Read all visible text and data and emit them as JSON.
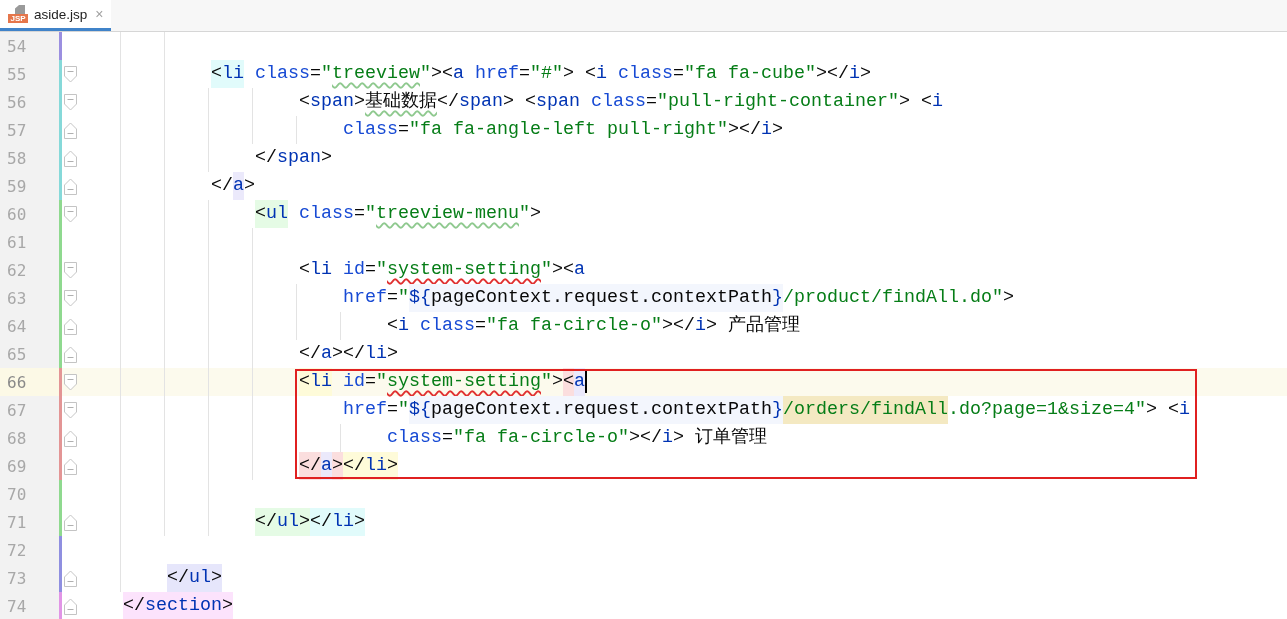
{
  "tab": {
    "title": "aside.jsp",
    "icon_text": "JSP",
    "close": "×",
    "selected": true
  },
  "lines": [
    {
      "number": "54",
      "color": "#9b8fe0",
      "fold_start": false,
      "fold_end": false
    },
    {
      "number": "55",
      "color": "#86d9d9",
      "fold_start": true,
      "fold_end": false,
      "tokens": [
        {
          "text": "            <",
          "kind": "punct",
          "color": "#e1fbfb"
        },
        {
          "text": "li",
          "kind": "tag",
          "color": "#e1fbfb"
        },
        {
          "text": " class",
          "kind": "attr"
        },
        {
          "text": "=",
          "kind": "punct"
        },
        {
          "text": "\"",
          "kind": "str"
        },
        {
          "text": "treeview",
          "kind": "str",
          "misspelled": true
        },
        {
          "text": "\"",
          "kind": "str"
        },
        {
          "text": "><",
          "kind": "punct"
        },
        {
          "text": "a",
          "kind": "tag"
        },
        {
          "text": " href",
          "kind": "attr"
        },
        {
          "text": "=",
          "kind": "punct"
        },
        {
          "text": "\"#\"",
          "kind": "str"
        },
        {
          "text": "> <",
          "kind": "punct"
        },
        {
          "text": "i",
          "kind": "tag"
        },
        {
          "text": " class",
          "kind": "attr"
        },
        {
          "text": "=",
          "kind": "punct"
        },
        {
          "text": "\"fa fa-cube\"",
          "kind": "str"
        },
        {
          "text": "></",
          "kind": "punct"
        },
        {
          "text": "i",
          "kind": "tag"
        },
        {
          "text": ">",
          "kind": "punct"
        }
      ]
    },
    {
      "number": "56",
      "color": "#86d9d9",
      "fold_start": true,
      "fold_end": false,
      "tokens": [
        {
          "text": "                    <",
          "kind": "punct"
        },
        {
          "text": "span",
          "kind": "tag"
        },
        {
          "text": ">",
          "kind": "punct"
        },
        {
          "text": "基础数据",
          "kind": "text",
          "misspelled": true
        },
        {
          "text": "</",
          "kind": "punct"
        },
        {
          "text": "span",
          "kind": "tag"
        },
        {
          "text": "> <",
          "kind": "punct"
        },
        {
          "text": "span",
          "kind": "tag"
        },
        {
          "text": " class",
          "kind": "attr"
        },
        {
          "text": "=",
          "kind": "punct"
        },
        {
          "text": "\"pull-right-container\"",
          "kind": "str"
        },
        {
          "text": "> <",
          "kind": "punct"
        },
        {
          "text": "i",
          "kind": "tag"
        }
      ]
    },
    {
      "number": "57",
      "color": "#86d9d9",
      "fold_start": false,
      "fold_end": true,
      "tokens": [
        {
          "text": "                        class",
          "kind": "attr"
        },
        {
          "text": "=",
          "kind": "punct"
        },
        {
          "text": "\"fa fa-angle-left pull-right\"",
          "kind": "str"
        },
        {
          "text": "></",
          "kind": "punct"
        },
        {
          "text": "i",
          "kind": "tag"
        },
        {
          "text": ">",
          "kind": "punct"
        }
      ]
    },
    {
      "number": "58",
      "color": "#86d9d9",
      "fold_start": false,
      "fold_end": true,
      "tokens": [
        {
          "text": "                </",
          "kind": "punct"
        },
        {
          "text": "span",
          "kind": "tag"
        },
        {
          "text": ">",
          "kind": "punct"
        }
      ]
    },
    {
      "number": "59",
      "color": "#86d9d9",
      "fold_start": false,
      "fold_end": true,
      "tokens": [
        {
          "text": "            </",
          "kind": "punct"
        },
        {
          "text": "a",
          "kind": "tag",
          "color": "#ebe9fb"
        },
        {
          "text": ">",
          "kind": "punct"
        }
      ]
    },
    {
      "number": "60",
      "color": "#8fd98f",
      "fold_start": true,
      "fold_end": false,
      "tokens": [
        {
          "text": "                <",
          "kind": "punct",
          "color": "#e5fbe5"
        },
        {
          "text": "ul",
          "kind": "tag",
          "color": "#e5fbe5"
        },
        {
          "text": " class",
          "kind": "attr"
        },
        {
          "text": "=",
          "kind": "punct"
        },
        {
          "text": "\"",
          "kind": "str"
        },
        {
          "text": "treeview-menu",
          "kind": "str",
          "misspelled": true
        },
        {
          "text": "\"",
          "kind": "str"
        },
        {
          "text": ">",
          "kind": "punct"
        }
      ]
    },
    {
      "number": "61",
      "color": "#8fd98f",
      "fold_start": false,
      "fold_end": false
    },
    {
      "number": "62",
      "color": "#8fd98f",
      "fold_start": true,
      "fold_end": false,
      "tokens": [
        {
          "text": "                    <",
          "kind": "punct"
        },
        {
          "text": "li",
          "kind": "tag"
        },
        {
          "text": " id",
          "kind": "attr"
        },
        {
          "text": "=",
          "kind": "punct"
        },
        {
          "text": "\"",
          "kind": "str"
        },
        {
          "text": "system-setting",
          "kind": "str",
          "error": true
        },
        {
          "text": "\"",
          "kind": "str"
        },
        {
          "text": "><",
          "kind": "punct"
        },
        {
          "text": "a",
          "kind": "tag"
        }
      ]
    },
    {
      "number": "63",
      "color": "#8fd98f",
      "fold_start": true,
      "fold_end": false,
      "tokens": [
        {
          "text": "                        href",
          "kind": "attr"
        },
        {
          "text": "=",
          "kind": "punct"
        },
        {
          "text": "\"",
          "kind": "str"
        },
        {
          "text": "${",
          "kind": "el",
          "color": "#f3f6fd"
        },
        {
          "text": "pageContext.request.contextPath",
          "kind": "text",
          "color": "#f3f6fd"
        },
        {
          "text": "}",
          "kind": "el",
          "color": "#f3f6fd"
        },
        {
          "text": "/product/findAll.do\"",
          "kind": "str"
        },
        {
          "text": ">",
          "kind": "punct"
        }
      ]
    },
    {
      "number": "64",
      "color": "#8fd98f",
      "fold_start": false,
      "fold_end": true,
      "tokens": [
        {
          "text": "                            <",
          "kind": "punct"
        },
        {
          "text": "i",
          "kind": "tag"
        },
        {
          "text": " class",
          "kind": "attr"
        },
        {
          "text": "=",
          "kind": "punct"
        },
        {
          "text": "\"fa fa-circle-o\"",
          "kind": "str"
        },
        {
          "text": "></",
          "kind": "punct"
        },
        {
          "text": "i",
          "kind": "tag"
        },
        {
          "text": ">",
          "kind": "punct"
        },
        {
          "text": " 产品管理",
          "kind": "text"
        }
      ]
    },
    {
      "number": "65",
      "color": "#8fd98f",
      "fold_start": false,
      "fold_end": true,
      "tokens": [
        {
          "text": "                    </",
          "kind": "punct"
        },
        {
          "text": "a",
          "kind": "tag"
        },
        {
          "text": "></",
          "kind": "punct"
        },
        {
          "text": "li",
          "kind": "tag"
        },
        {
          "text": ">",
          "kind": "punct"
        }
      ]
    },
    {
      "number": "66",
      "color": "#e39595",
      "fold_start": true,
      "fold_end": false,
      "current": true,
      "annotated": true,
      "tokens": [
        {
          "text": "                    <",
          "kind": "punct",
          "color": "#fefbd9"
        },
        {
          "text": "li",
          "kind": "tag",
          "color": "#fefbd9"
        },
        {
          "text": " id",
          "kind": "attr"
        },
        {
          "text": "=",
          "kind": "punct"
        },
        {
          "text": "\"",
          "kind": "str"
        },
        {
          "text": "system-setting",
          "kind": "str",
          "error": true
        },
        {
          "text": "\"",
          "kind": "str"
        },
        {
          "text": ">",
          "kind": "punct"
        },
        {
          "text": "<",
          "kind": "punct",
          "color": "#fbdede"
        },
        {
          "text": "a",
          "kind": "tag",
          "color": "#ebe9fb",
          "caret": true
        }
      ]
    },
    {
      "number": "67",
      "color": "#e39595",
      "fold_start": true,
      "fold_end": false,
      "annotated": true,
      "tokens": [
        {
          "text": "                        href",
          "kind": "attr"
        },
        {
          "text": "=",
          "kind": "punct"
        },
        {
          "text": "\"",
          "kind": "str"
        },
        {
          "text": "${",
          "kind": "el",
          "color": "#f3f6fd"
        },
        {
          "text": "pageContext.request.contextPath",
          "kind": "text",
          "color": "#f3f6fd"
        },
        {
          "text": "}",
          "kind": "el",
          "color": "#f3f6fd"
        },
        {
          "text": "/orders/findAll",
          "kind": "str",
          "color": "#f4e9c2"
        },
        {
          "text": ".do?page=1&size=4\"",
          "kind": "str"
        },
        {
          "text": "> <",
          "kind": "punct"
        },
        {
          "text": "i",
          "kind": "tag"
        }
      ]
    },
    {
      "number": "68",
      "color": "#e39595",
      "fold_start": false,
      "fold_end": true,
      "annotated": true,
      "tokens": [
        {
          "text": "                            class",
          "kind": "attr"
        },
        {
          "text": "=",
          "kind": "punct"
        },
        {
          "text": "\"fa fa-circle-o\"",
          "kind": "str"
        },
        {
          "text": "></",
          "kind": "punct"
        },
        {
          "text": "i",
          "kind": "tag"
        },
        {
          "text": ">",
          "kind": "punct"
        },
        {
          "text": " 订单管理",
          "kind": "text"
        }
      ]
    },
    {
      "number": "69",
      "color": "#e39595",
      "fold_start": false,
      "fold_end": true,
      "annotated": true,
      "tokens": [
        {
          "text": "                    </",
          "kind": "punct",
          "color": "#fbdede"
        },
        {
          "text": "a",
          "kind": "tag",
          "color": "#ebe9fb"
        },
        {
          "text": ">",
          "kind": "punct",
          "color": "#fbdede"
        },
        {
          "text": "</",
          "kind": "punct",
          "color": "#fefbd9"
        },
        {
          "text": "li",
          "kind": "tag",
          "color": "#fefbd9"
        },
        {
          "text": ">",
          "kind": "punct",
          "color": "#fefbd9"
        }
      ]
    },
    {
      "number": "70",
      "color": "#8fd98f",
      "fold_start": false,
      "fold_end": false
    },
    {
      "number": "71",
      "color": "#8fd98f",
      "fold_start": false,
      "fold_end": true,
      "tokens": [
        {
          "text": "                </",
          "kind": "punct",
          "color": "#e5fbe5"
        },
        {
          "text": "ul",
          "kind": "tag",
          "color": "#e5fbe5"
        },
        {
          "text": ">",
          "kind": "punct",
          "color": "#e5fbe5"
        },
        {
          "text": "</",
          "kind": "punct",
          "color": "#e1fbfb"
        },
        {
          "text": "li",
          "kind": "tag",
          "color": "#e1fbfb"
        },
        {
          "text": ">",
          "kind": "punct",
          "color": "#e1fbfb"
        }
      ]
    },
    {
      "number": "72",
      "color": "#8f8fe0",
      "fold_start": false,
      "fold_end": false
    },
    {
      "number": "73",
      "color": "#8f8fe0",
      "fold_start": false,
      "fold_end": true,
      "tokens": [
        {
          "text": "        </",
          "kind": "punct",
          "color": "#e6e6fb"
        },
        {
          "text": "ul",
          "kind": "tag",
          "color": "#e6e6fb"
        },
        {
          "text": ">",
          "kind": "punct",
          "color": "#e6e6fb"
        }
      ]
    },
    {
      "number": "74",
      "color": "#e195e6",
      "fold_start": false,
      "fold_end": true,
      "tokens": [
        {
          "text": "    </",
          "kind": "punct",
          "color": "#fce3fc"
        },
        {
          "text": "section",
          "kind": "tag",
          "color": "#fce3fc"
        },
        {
          "text": ">",
          "kind": "punct",
          "color": "#fce3fc"
        }
      ]
    }
  ]
}
